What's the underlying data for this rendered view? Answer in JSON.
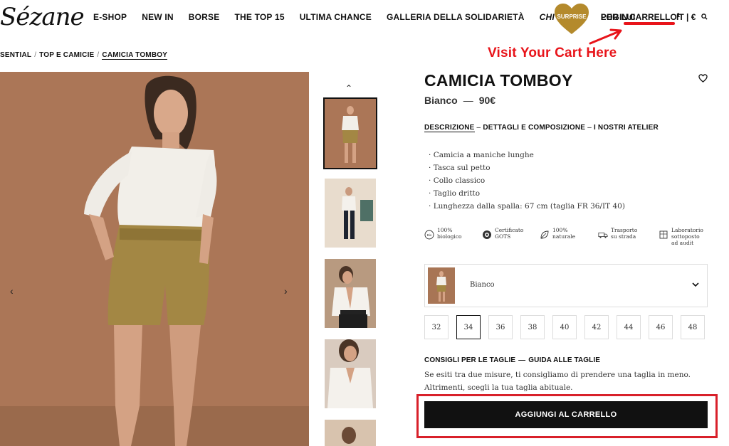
{
  "header": {
    "logo": "Sézane",
    "nav": [
      {
        "label": "E-SHOP",
        "italic": false
      },
      {
        "label": "NEW IN",
        "italic": false
      },
      {
        "label": "BORSE",
        "italic": false
      },
      {
        "label": "THE TOP 15",
        "italic": false
      },
      {
        "label": "ULTIMA CHANCE",
        "italic": false
      },
      {
        "label": "GALLERIA DELLA SOLIDARIETÀ",
        "italic": false
      },
      {
        "label": "CHI SIAMO",
        "italic": true
      },
      {
        "label": "PER LUI",
        "italic": false
      }
    ],
    "surprise": "SURPRISE",
    "login": "LOGIN",
    "cart": "CARRELLO",
    "cart_count": "1",
    "lang": "IT | €"
  },
  "annotation": {
    "text": "Visit Your Cart Here"
  },
  "breadcrumb": [
    "SENTIAL",
    "TOP E CAMICIE",
    "CAMICIA TOMBOY"
  ],
  "product": {
    "title": "CAMICIA TOMBOY",
    "color": "Bianco",
    "price": "90€",
    "tabs": [
      "DESCRIZIONE",
      "DETTAGLI E COMPOSIZIONE",
      "I NOSTRI ATELIER"
    ],
    "features": [
      "Camicia a maniche lunghe",
      "Tasca sul petto",
      "Collo classico",
      "Taglio dritto",
      "Lunghezza dalla spalla: 67 cm (taglia FR 36/IT 40)"
    ],
    "badges": [
      {
        "icon": "bio-icon",
        "line1": "100%",
        "line2": "biologico",
        "line3": ""
      },
      {
        "icon": "gots-icon",
        "line1": "Certificato",
        "line2": "GOTS",
        "line3": ""
      },
      {
        "icon": "leaf-icon",
        "line1": "100%",
        "line2": "naturale",
        "line3": ""
      },
      {
        "icon": "truck-icon",
        "line1": "Trasporto",
        "line2": "su strada",
        "line3": ""
      },
      {
        "icon": "building-icon",
        "line1": "Laboratorio",
        "line2": "sottoposto",
        "line3": "ad audit"
      }
    ],
    "color_select_label": "Bianco",
    "sizes": [
      "32",
      "34",
      "36",
      "38",
      "40",
      "42",
      "44",
      "46",
      "48"
    ],
    "selected_size": "34",
    "size_advice_title": "CONSIGLI PER LE TAGLIE",
    "size_guide_link": "GUIDA ALLE TAGLIE",
    "size_advice_line1": "Se esiti tra due misure, ti consigliamo di prendere una taglia in meno.",
    "size_advice_line2": "Altrimenti, scegli la tua taglia abituale.",
    "add_to_cart": "AGGIUNGI AL CARRELLO"
  },
  "colors": {
    "accent_red": "#e8141a",
    "surprise_gold": "#b48a2c",
    "button_black": "#111111"
  }
}
